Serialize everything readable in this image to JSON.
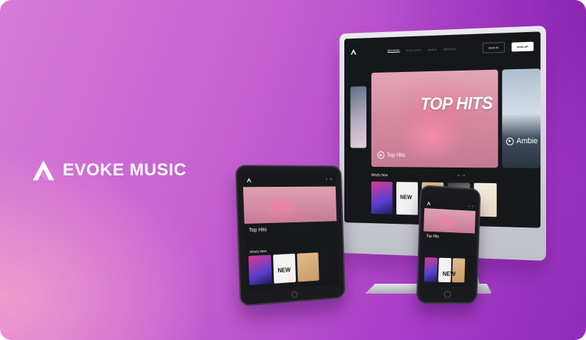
{
  "brand": {
    "name": "EVOKE MUSIC",
    "logo_icon": "evoke-a-logo-icon",
    "text_color": "#ffffff"
  },
  "background": {
    "gradient_from": "#d87ad6",
    "gradient_to": "#8f2bb8"
  },
  "desktop": {
    "nav_items": [
      "BROWSE",
      "PLAYLISTS",
      "RADIO",
      "ARTISTS"
    ],
    "sign_in": "SIGN IN",
    "sign_up": "SIGN UP",
    "hero_title": "TOP HITS",
    "hero_caption": "Top Hits",
    "hero_right_caption": "Ambie",
    "section_title": "What's New",
    "album_label_new": "NEW",
    "album_label_rock": "ROCK OUT!"
  },
  "tablet": {
    "title": "Top Hits",
    "section_title": "What's New"
  },
  "phone": {
    "title": "Top Hits"
  }
}
